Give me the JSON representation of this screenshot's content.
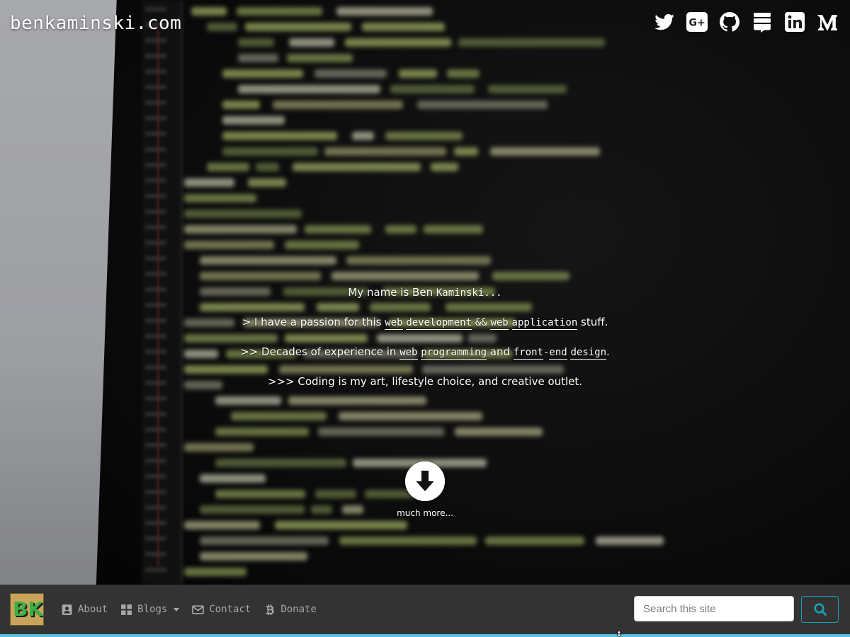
{
  "site": {
    "title": "benkaminski.com"
  },
  "social": [
    {
      "name": "Twitter",
      "icon": "twitter-icon"
    },
    {
      "name": "Google+",
      "icon": "google-plus-icon"
    },
    {
      "name": "GitHub",
      "icon": "github-icon"
    },
    {
      "name": "Stack Exchange",
      "icon": "stack-exchange-icon"
    },
    {
      "name": "LinkedIn",
      "icon": "linkedin-icon"
    },
    {
      "name": "Medium",
      "icon": "medium-icon"
    }
  ],
  "intro": {
    "line1_pre": "My name is Ben",
    "line1_name": "Kaminski...",
    "line2": {
      "prefix": "> I have a passion for this",
      "kw1": "web",
      "kw2": "development",
      "amp": "&&",
      "kw3": "web",
      "kw4": "application",
      "suffix": "stuff."
    },
    "line3": {
      "prefix": ">> Decades of experience in",
      "kw1": "web",
      "kw2": "programming",
      "and": "and",
      "kw3": "front",
      "dash": "-",
      "kw4": "end",
      "kw5": "design",
      "suffix": "."
    },
    "line4": ">>> Coding is my art, lifestyle choice, and creative outlet."
  },
  "more": {
    "label": "much more...",
    "icon": "arrow-down-circle-icon"
  },
  "nav": {
    "brand": "BK",
    "items": [
      {
        "label": "About",
        "icon": "user-badge-icon"
      },
      {
        "label": "Blogs",
        "icon": "grid-icon",
        "dropdown": true
      },
      {
        "label": "Contact",
        "icon": "envelope-icon"
      },
      {
        "label": "Donate",
        "icon": "bitcoin-icon"
      }
    ],
    "search": {
      "placeholder": "Search this site",
      "button_icon": "search-icon"
    }
  },
  "colors": {
    "nav_bg": "#333333",
    "nav_accent": "#5bc0de",
    "search_button": "#17a2b8",
    "nav_text": "#a8a8a8",
    "brand_bg": "#c8a55a",
    "brand_text": "#3cb043"
  }
}
